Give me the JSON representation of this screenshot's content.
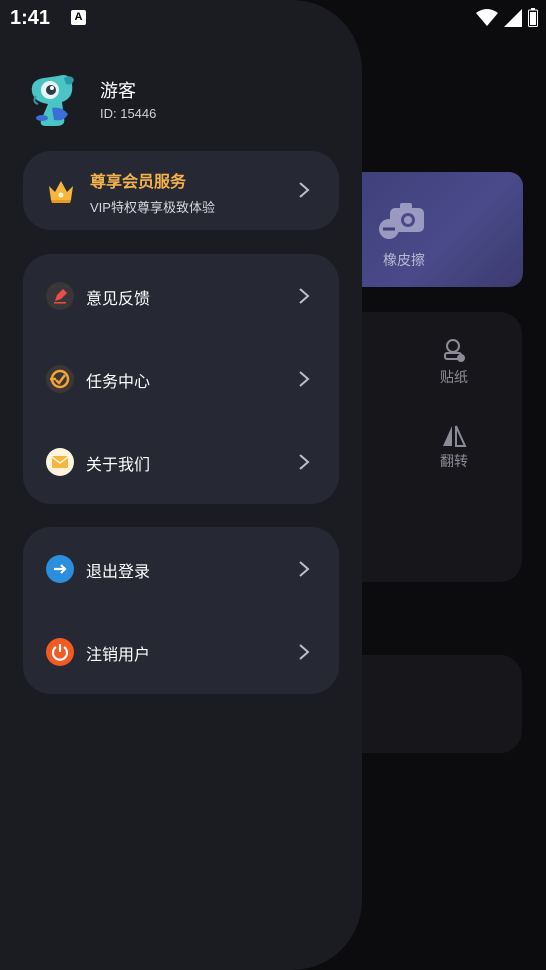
{
  "status_bar": {
    "time": "1:41",
    "notification_icon": "A"
  },
  "background": {
    "eraser_label": "橡皮擦",
    "sticker_label": "贴纸",
    "flip_label": "翻转"
  },
  "user": {
    "name": "游客",
    "id_text": "ID: 15446"
  },
  "vip": {
    "title": "尊享会员服务",
    "subtitle": "VIP特权尊享极致体验"
  },
  "menu": {
    "feedback": "意见反馈",
    "tasks": "任务中心",
    "about": "关于我们",
    "logout": "退出登录",
    "deregister": "注销用户"
  },
  "colors": {
    "drawer_bg": "#1b1c22",
    "card_bg": "#262833",
    "vip_accent": "#f4b24a",
    "logout_icon": "#2b8fdd",
    "deregister_icon": "#f15a22"
  }
}
